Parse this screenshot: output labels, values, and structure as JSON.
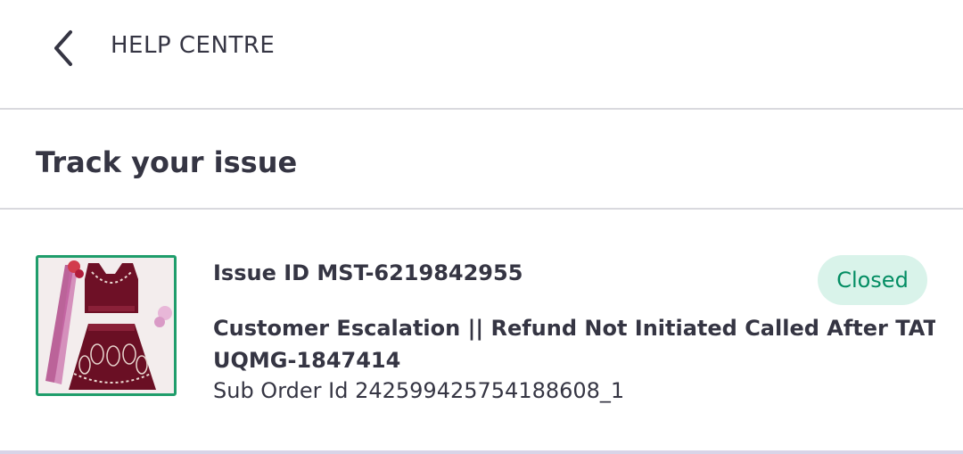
{
  "header": {
    "back_icon": "chevron-left-icon",
    "title": "HELP CENTRE"
  },
  "section": {
    "title": "Track your issue"
  },
  "issue": {
    "id_text": "Issue ID MST-6219842955",
    "status": "Closed",
    "status_color": "#038d63",
    "status_bg": "#d9f3ea",
    "description_line1": "Customer Escalation || Refund Not Initiated Called After TAT Prepa",
    "description_line2": "UQMG-1847414",
    "sub_order": "Sub Order Id 242599425754188608_1",
    "thumbnail_border": "#1f9d6b"
  }
}
